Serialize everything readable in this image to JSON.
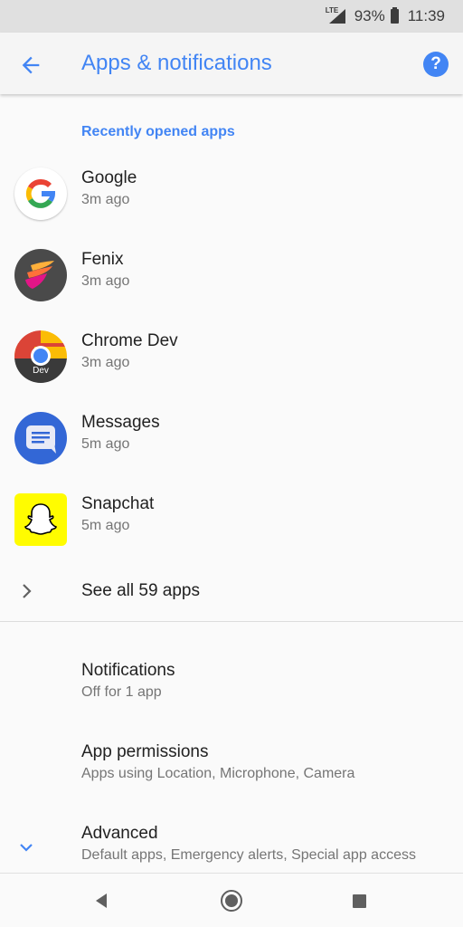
{
  "status_bar": {
    "network": "LTE",
    "battery": "93%",
    "time": "11:39"
  },
  "app_bar": {
    "title": "Apps & notifications",
    "help_label": "?"
  },
  "recent": {
    "header": "Recently opened apps",
    "apps": [
      {
        "name": "Google",
        "time": "3m ago",
        "icon": "google-icon"
      },
      {
        "name": "Fenix",
        "time": "3m ago",
        "icon": "fenix-icon"
      },
      {
        "name": "Chrome Dev",
        "time": "3m ago",
        "icon": "chrome-dev-icon",
        "badge": "Dev"
      },
      {
        "name": "Messages",
        "time": "5m ago",
        "icon": "messages-icon"
      },
      {
        "name": "Snapchat",
        "time": "5m ago",
        "icon": "snapchat-icon"
      }
    ],
    "see_all": "See all 59 apps"
  },
  "settings": [
    {
      "title": "Notifications",
      "subtitle": "Off for 1 app"
    },
    {
      "title": "App permissions",
      "subtitle": "Apps using Location, Microphone, Camera"
    },
    {
      "title": "Advanced",
      "subtitle": "Default apps, Emergency alerts, Special app access"
    }
  ],
  "colors": {
    "accent": "#4285f4",
    "snapchat": "#fffc00",
    "messages": "#3367d6"
  }
}
